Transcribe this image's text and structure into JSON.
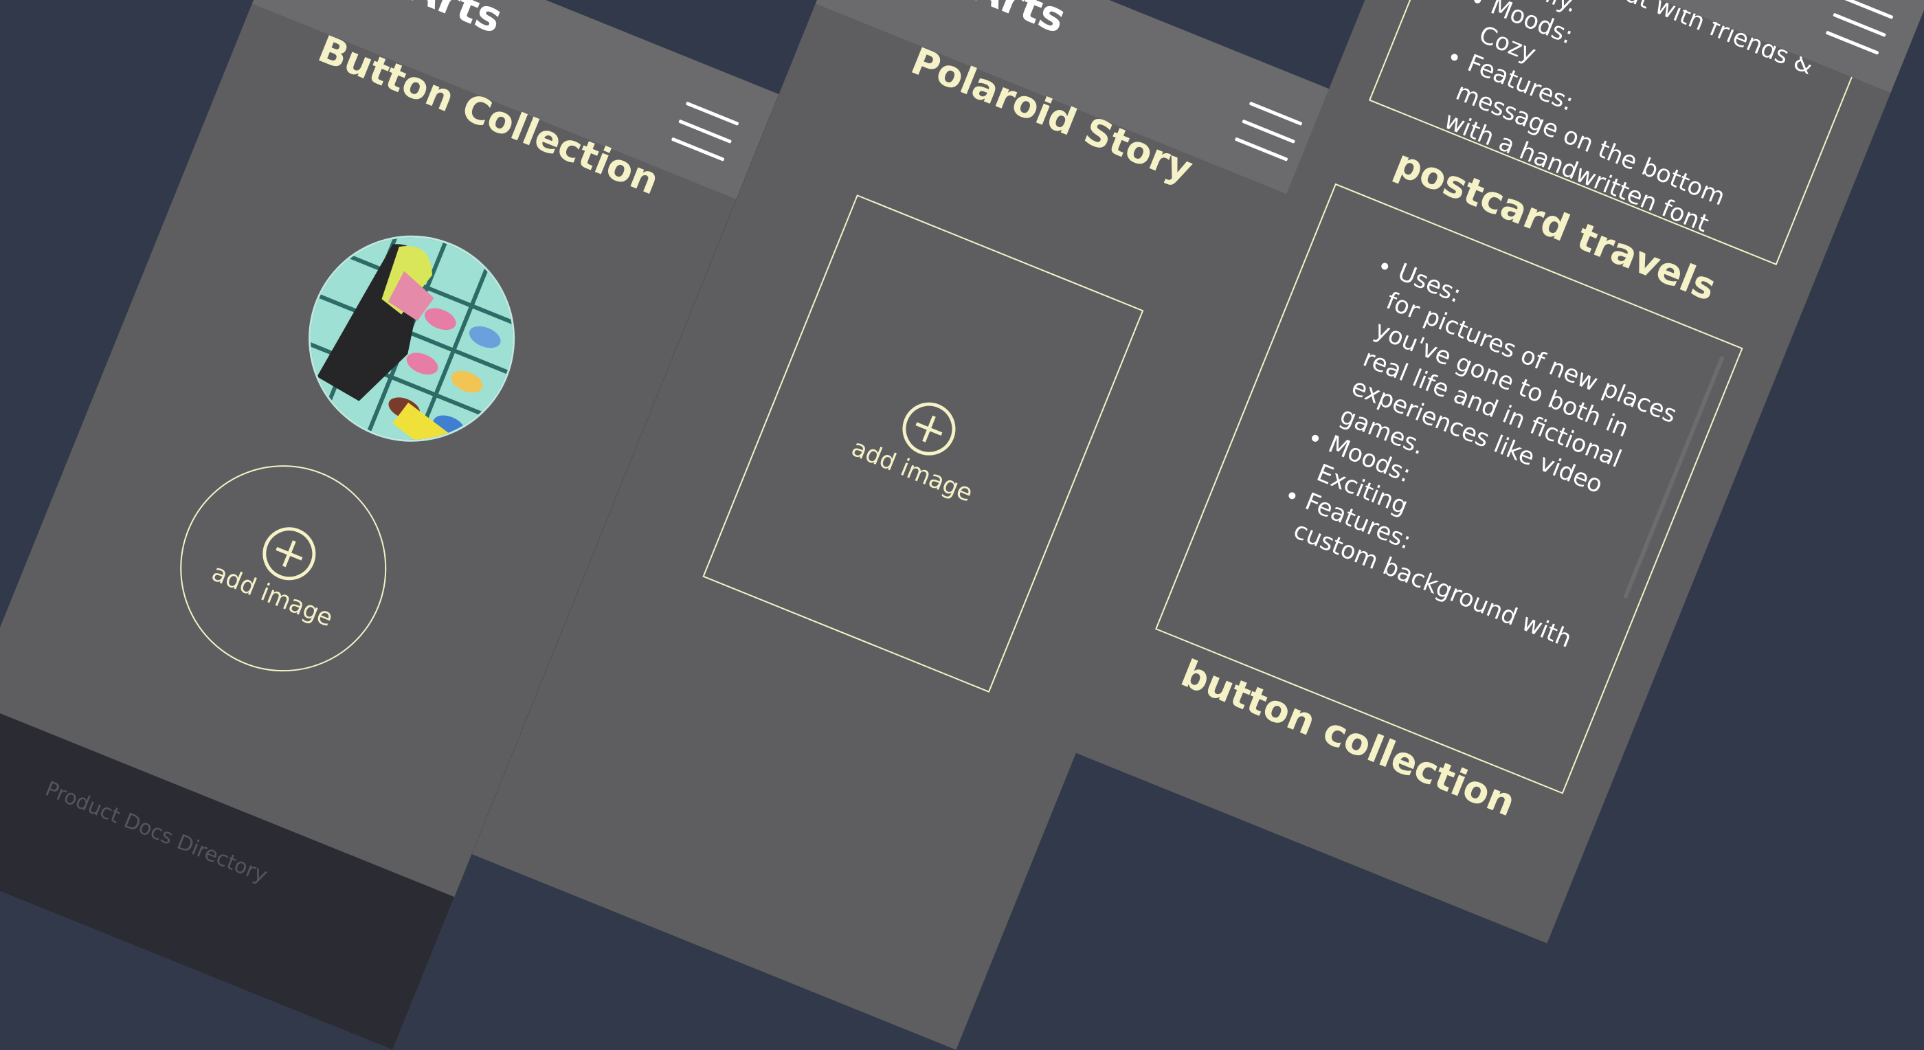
{
  "app": {
    "title": "User Arts"
  },
  "screen1": {
    "page_title": "Button Collection",
    "add_label": "add image",
    "footer_text": "Product Docs Directory"
  },
  "screen2": {
    "page_title": "Polaroid Story",
    "add_label": "add image"
  },
  "screen3": {
    "card1": {
      "items": [
        {
          "label": "",
          "value": "hanging out with friends & family."
        },
        {
          "label": "Moods:",
          "value": "Cozy"
        },
        {
          "label": "Features:",
          "value": "message on the bottom with a handwritten font"
        }
      ]
    },
    "card2": {
      "title": "postcard travels",
      "items": [
        {
          "label": "Uses:",
          "value": "for pictures of new places you've gone to both in real life and in fictional experiences like video games."
        },
        {
          "label": "Moods:",
          "value": "Exciting"
        },
        {
          "label": "Features:",
          "value": "custom background with"
        }
      ]
    },
    "next_title": "button collection"
  },
  "colors": {
    "background": "#31394a",
    "panel": "#5e5e60",
    "header": "#6b6b6d",
    "accent": "#f5f2c8"
  }
}
